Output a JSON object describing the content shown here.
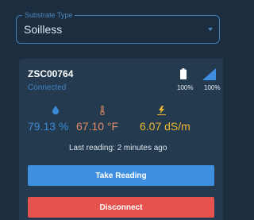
{
  "substrate": {
    "legend": "Substrate Type",
    "value": "Soilless"
  },
  "device": {
    "id": "ZSC00764",
    "status": "Connected",
    "battery_pct": "100%",
    "signal_pct": "100%"
  },
  "metrics": {
    "moisture": "79.13 %",
    "temperature": "67.10 °F",
    "ec": "6.07 dS/m"
  },
  "last_reading": "Last reading: 2 minutes ago",
  "buttons": {
    "take_reading": "Take Reading",
    "disconnect": "Disconnect"
  },
  "icons": {
    "dropdown": "chevron-down-icon",
    "battery": "battery-icon",
    "signal": "signal-icon",
    "moisture": "droplet-icon",
    "temperature": "thermometer-icon",
    "ec": "lightning-icon"
  },
  "colors": {
    "background": "#1b2d3e",
    "card": "#243a4f",
    "accent_blue": "#3f8fe0",
    "danger": "#e5534f",
    "moisture": "#3c8ad6",
    "temperature": "#e88d63",
    "ec": "#f0b730"
  }
}
